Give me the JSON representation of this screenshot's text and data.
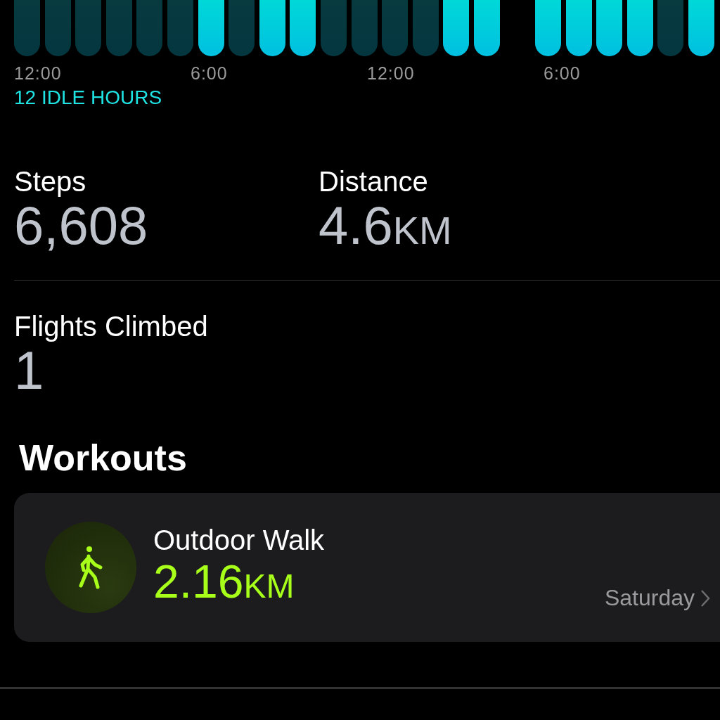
{
  "stand_chart": {
    "hours": [
      {
        "kind": "idle"
      },
      {
        "kind": "idle"
      },
      {
        "kind": "idle"
      },
      {
        "kind": "idle"
      },
      {
        "kind": "idle"
      },
      {
        "kind": "idle"
      },
      {
        "kind": "active"
      },
      {
        "kind": "idle"
      },
      {
        "kind": "active"
      },
      {
        "kind": "active"
      },
      {
        "kind": "idle"
      },
      {
        "kind": "idle"
      },
      {
        "kind": "idle"
      },
      {
        "kind": "idle"
      },
      {
        "kind": "active"
      },
      {
        "kind": "active"
      },
      {
        "kind": "empty"
      },
      {
        "kind": "active"
      },
      {
        "kind": "active"
      },
      {
        "kind": "active"
      },
      {
        "kind": "active"
      },
      {
        "kind": "idle"
      },
      {
        "kind": "active"
      }
    ],
    "time_labels": [
      "12:00",
      "6:00",
      "12:00",
      "6:00"
    ],
    "summary": "12 IDLE HOURS"
  },
  "metrics": [
    {
      "label": "Steps",
      "value": "6,608"
    },
    {
      "label": "Distance",
      "value": "4.6",
      "unit": "KM"
    },
    {
      "label": "Flights Climbed",
      "value": "1"
    }
  ],
  "workouts": {
    "title": "Workouts",
    "items": [
      {
        "name": "Outdoor Walk",
        "value": "2.16",
        "unit": "KM",
        "date": "Saturday"
      }
    ]
  }
}
